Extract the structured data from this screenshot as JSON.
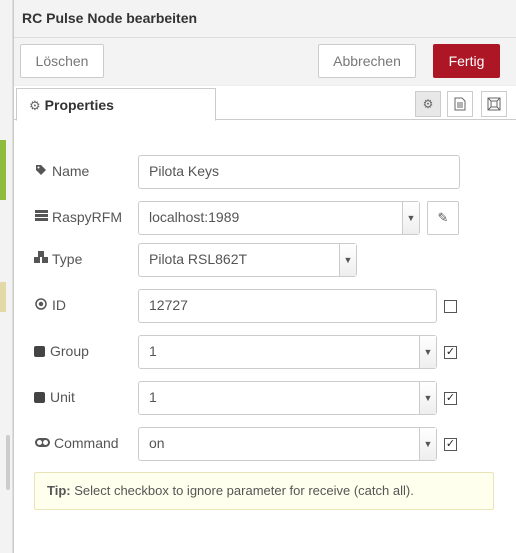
{
  "header": {
    "title": "RC Pulse Node bearbeiten"
  },
  "toolbar": {
    "delete_label": "Löschen",
    "cancel_label": "Abbrechen",
    "done_label": "Fertig",
    "done_color": "#ad1625"
  },
  "tabs": {
    "properties_label": "Properties"
  },
  "form": {
    "name": {
      "label": "Name",
      "value": "Pilota Keys"
    },
    "raspyrfm": {
      "label": "RaspyRFM",
      "value": "localhost:1989"
    },
    "type": {
      "label": "Type",
      "value": "Pilota RSL862T"
    },
    "id": {
      "label": "ID",
      "value": "12727",
      "ignore_checked": false
    },
    "group": {
      "label": "Group",
      "value": "1",
      "ignore_checked": true
    },
    "unit": {
      "label": "Unit",
      "value": "1",
      "ignore_checked": true
    },
    "command": {
      "label": "Command",
      "value": "on",
      "ignore_checked": true
    }
  },
  "tip": {
    "prefix": "Tip:",
    "text": " Select checkbox to ignore parameter for receive (catch all)."
  },
  "icons": {
    "check": "✓"
  }
}
